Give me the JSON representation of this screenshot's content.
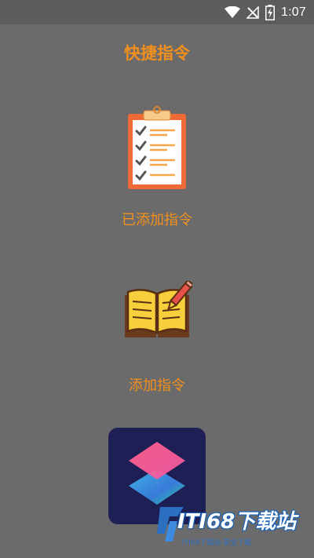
{
  "status_bar": {
    "time": "1:07",
    "icons": [
      "wifi-icon",
      "no-signal-icon",
      "battery-charging-icon"
    ]
  },
  "header": {
    "title": "快捷指令"
  },
  "features": [
    {
      "icon": "clipboard-checklist-icon",
      "label": "已添加指令"
    },
    {
      "icon": "open-book-pencil-icon",
      "label": "添加指令"
    }
  ],
  "app_tile": {
    "icon": "shortcuts-app-icon"
  },
  "watermark": {
    "text": "ITI68下载站",
    "subtext": "ITI68下载站·安全下载"
  },
  "colors": {
    "background": "#6b6b6b",
    "status_bar": "#5c5c5c",
    "accent": "#f3901c"
  }
}
